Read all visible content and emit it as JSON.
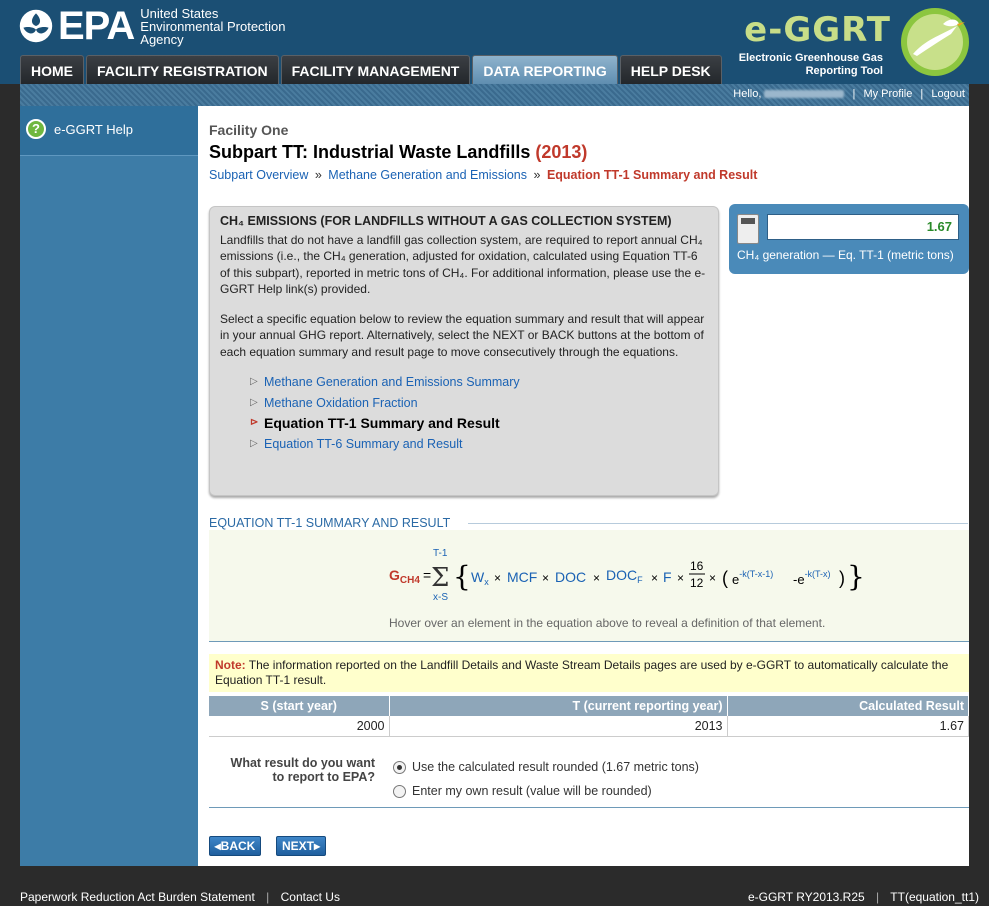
{
  "header": {
    "epa_abbrev": "EPA",
    "epa_agency_line1": "United States",
    "epa_agency_line2": "Environmental Protection",
    "epa_agency_line3": "Agency",
    "tool_name": "e-GGRT",
    "tool_sub_line1": "Electronic Greenhouse Gas",
    "tool_sub_line2": "Reporting Tool"
  },
  "nav": {
    "tabs": [
      {
        "label": "HOME",
        "active": false
      },
      {
        "label": "FACILITY REGISTRATION",
        "active": false
      },
      {
        "label": "FACILITY MANAGEMENT",
        "active": false
      },
      {
        "label": "DATA REPORTING",
        "active": true
      },
      {
        "label": "HELP DESK",
        "active": false
      }
    ]
  },
  "userbar": {
    "hello": "Hello,",
    "my_profile": "My Profile",
    "logout": "Logout"
  },
  "sidebar": {
    "help_label": "e-GGRT Help"
  },
  "main": {
    "facility": "Facility One",
    "subpart_title": "Subpart TT: Industrial Waste Landfills",
    "year": "(2013)",
    "crumbs": {
      "overview": "Subpart Overview",
      "methane": "Methane Generation and Emissions",
      "current": "Equation TT-1 Summary and Result",
      "sep": "»"
    },
    "info": {
      "title": "CH₄ EMISSIONS (FOR LANDFILLS WITHOUT A GAS COLLECTION SYSTEM)",
      "p1": "Landfills that do not have a landfill gas collection system, are required to report annual CH₄ emissions (i.e., the CH₄ generation, adjusted for oxidation, calculated using Equation TT-6 of this subpart), reported in metric tons of CH₄. For additional information, please use the e-GGRT Help link(s) provided.",
      "p2": "Select a specific equation below to review the equation summary and result that will appear in your annual GHG report. Alternatively, select the NEXT or BACK buttons at the bottom of each equation summary and result page to move consecutively through the equations.",
      "links": [
        {
          "label": "Methane Generation and Emissions Summary",
          "active": false
        },
        {
          "label": "Methane Oxidation Fraction",
          "active": false
        },
        {
          "label": "Equation TT-1 Summary and Result",
          "active": true
        },
        {
          "label": "Equation TT-6 Summary and Result",
          "active": false
        }
      ]
    },
    "calc": {
      "value": "1.67",
      "label": "CH₄ generation — Eq. TT-1 (metric tons)"
    },
    "equation_section": {
      "title": "EQUATION TT-1 SUMMARY AND RESULT",
      "lhs": "G",
      "lhs_sub": "CH4",
      "sum_top": "T-1",
      "sum_bottom": "x-S",
      "w": "W",
      "w_sub": "x",
      "mcf": "MCF",
      "doc": "DOC",
      "docf": "DOC",
      "docf_sub": "F",
      "f": "F",
      "frac_num": "16",
      "frac_den": "12",
      "exp1": "-k(T-x-1)",
      "exp2": "-k(T-x)",
      "hover_hint": "Hover over an element in the equation above to reveal a definition of that element."
    },
    "note": {
      "label": "Note:",
      "text": "The information reported on the Landfill Details and Waste Stream Details pages are used by e-GGRT to automatically calculate the Equation TT-1 result."
    },
    "table": {
      "headers": [
        "S (start year)",
        "T (current reporting year)",
        "Calculated Result"
      ],
      "row": [
        "2000",
        "2013",
        "1.67"
      ]
    },
    "report": {
      "question": "What result do you want to report to EPA?",
      "option1": "Use the calculated result rounded (1.67 metric tons)",
      "option2": "Enter my own result (value will be rounded)",
      "selected": 1
    },
    "buttons": {
      "back": "◂BACK",
      "next": "NEXT▸"
    }
  },
  "footer": {
    "paperwork": "Paperwork Reduction Act Burden Statement",
    "contact": "Contact Us",
    "version": "e-GGRT RY2013.R25",
    "page_id": "TT(equation_tt1)"
  }
}
